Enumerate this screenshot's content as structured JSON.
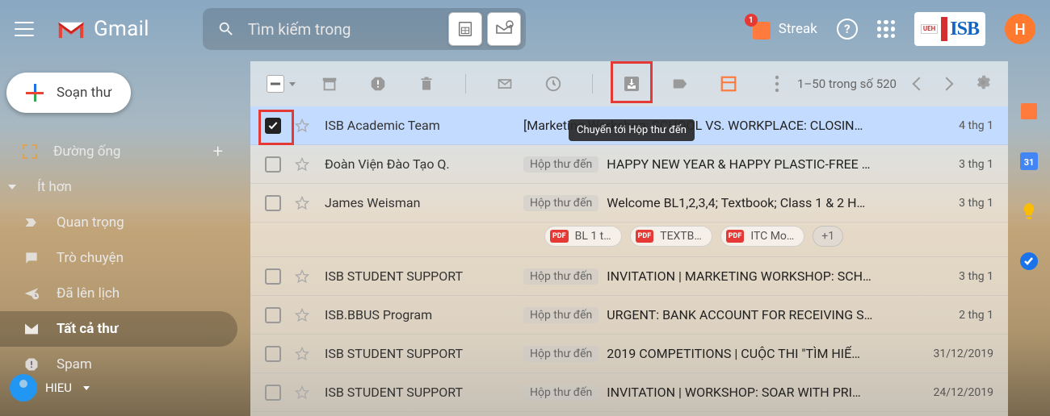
{
  "header": {
    "app_name": "Gmail",
    "search_placeholder": "Tìm kiếm trong",
    "streak": {
      "label": "Streak",
      "badge": "1"
    },
    "brand": {
      "ueh": "UEH",
      "isb": "ISB"
    },
    "avatar_initial": "H"
  },
  "compose_label": "Soạn thư",
  "sidebar": {
    "pipeline": "Đường ống",
    "less": "Ít hơn",
    "items": [
      {
        "label": "Quan trọng",
        "key": "important"
      },
      {
        "label": "Trò chuyện",
        "key": "chats"
      },
      {
        "label": "Đã lên lịch",
        "key": "scheduled"
      },
      {
        "label": "Tất cả thư",
        "key": "allmail",
        "selected": true
      },
      {
        "label": "Spam",
        "key": "spam"
      }
    ]
  },
  "user_chip": {
    "name": "HIEU"
  },
  "toolbar": {
    "pager": "1–50 trong số 520",
    "tooltip": "Chuyển tới Hộp thư đến"
  },
  "inbox_label": "Hộp thư đến",
  "emails": [
    {
      "selected": true,
      "sender": "ISB Academic Team",
      "subject": "[Marketing Workshop: SCHOOL VS. WORKPLACE: CLOSIN…",
      "date": "4 thg 1",
      "show_inbox_label": false
    },
    {
      "sender": "Đoàn Viện Đào Tạo Q.",
      "subject": "HAPPY NEW YEAR & HAPPY PLASTIC-FREE …",
      "date": "3 thg 1",
      "show_inbox_label": true
    },
    {
      "sender": "James Weisman",
      "subject": "Welcome BL1,2,3,4; Textbook; Class 1 & 2 H…",
      "date": "3 thg 1",
      "show_inbox_label": true,
      "attachments": [
        {
          "name": "BL 1 t…"
        },
        {
          "name": "TEXTB…"
        },
        {
          "name": "ITC Mo…"
        }
      ],
      "attach_more": "+1"
    },
    {
      "sender": "ISB STUDENT SUPPORT",
      "subject": "INVITATION | MARKETING WORKSHOP: SCH…",
      "date": "3 thg 1",
      "show_inbox_label": true
    },
    {
      "sender": "ISB.BBUS Program",
      "subject": "URGENT: BANK ACCOUNT FOR RECEIVING S…",
      "date": "2 thg 1",
      "show_inbox_label": true
    },
    {
      "sender": "ISB STUDENT SUPPORT",
      "subject": "2019 COMPETITIONS | CUỘC THI \"TÌM HIỂ…",
      "date": "31/12/2019",
      "show_inbox_label": true
    },
    {
      "sender": "ISB STUDENT SUPPORT",
      "subject": "INVITATION | WORKSHOP: SOAR WITH PRI…",
      "date": "24/12/2019",
      "show_inbox_label": true
    }
  ]
}
